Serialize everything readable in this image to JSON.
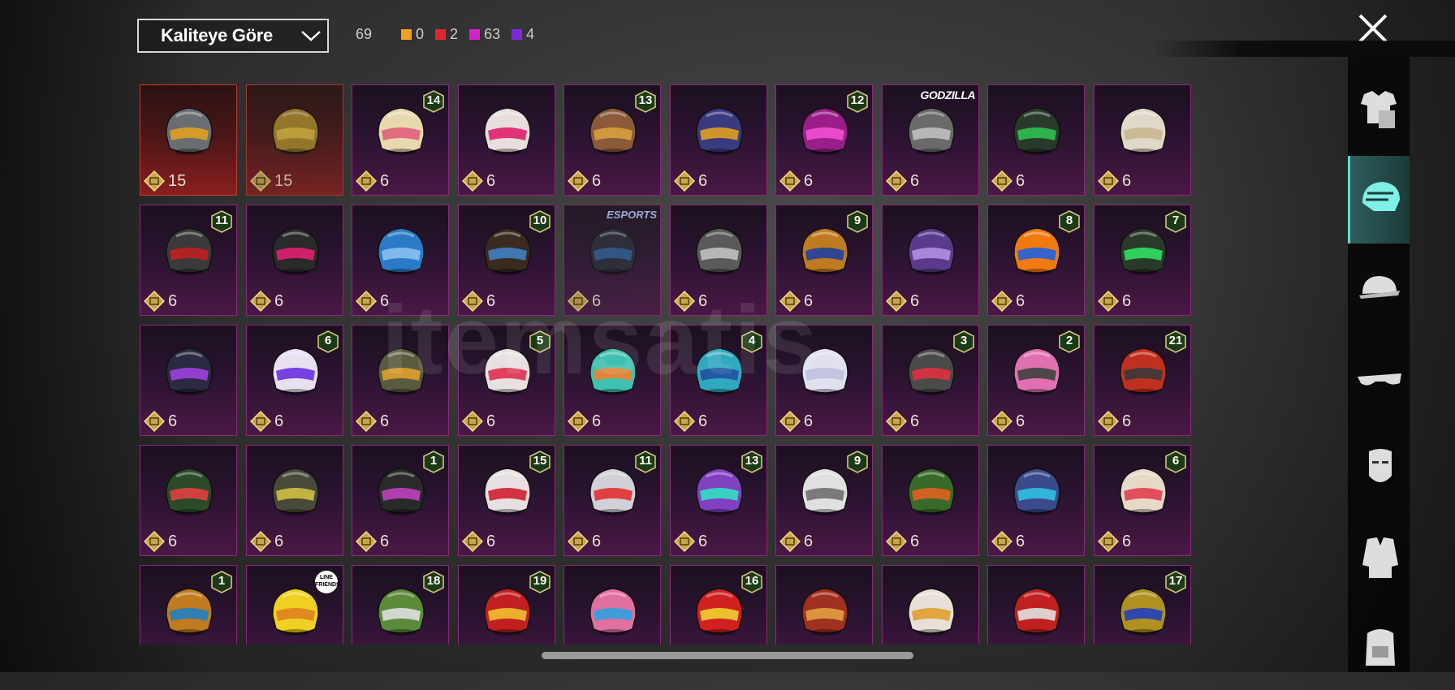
{
  "sort": {
    "label": "Kaliteye Göre"
  },
  "counts": {
    "total": "69",
    "items": [
      {
        "color": "#f2a01d",
        "value": "0"
      },
      {
        "color": "#e0262e",
        "value": "2"
      },
      {
        "color": "#d423c9",
        "value": "63"
      },
      {
        "color": "#7a2ad8",
        "value": "4"
      }
    ]
  },
  "watermark": "itemsatis",
  "tiles": [
    {
      "price": "15",
      "quality": "red",
      "helmet": "#6a6e72",
      "accent": "#e0a020"
    },
    {
      "price": "15",
      "quality": "red",
      "helmet": "#b08a2a",
      "accent": "#e8c040",
      "dim": true
    },
    {
      "price": "6",
      "helmet": "#e8d8b0",
      "accent": "#e0607a",
      "badge": "14"
    },
    {
      "price": "6",
      "helmet": "#e8dede",
      "accent": "#e0206e"
    },
    {
      "price": "6",
      "helmet": "#8a5a3a",
      "accent": "#d8a040",
      "badge": "13"
    },
    {
      "price": "6",
      "helmet": "#3a3a80",
      "accent": "#e0a020"
    },
    {
      "price": "6",
      "helmet": "#9a1e8a",
      "accent": "#f050d0",
      "badge": "12"
    },
    {
      "price": "6",
      "helmet": "#6a6a6a",
      "accent": "#c0c0c0",
      "label": "GODZILLA"
    },
    {
      "price": "6",
      "helmet": "#2a3a2a",
      "accent": "#30c050"
    },
    {
      "price": "6",
      "helmet": "#e0d8c8",
      "accent": "#c8b890"
    },
    {
      "price": "6",
      "helmet": "#3a3a3a",
      "accent": "#c02020",
      "badge": "11"
    },
    {
      "price": "6",
      "helmet": "#2a2a2a",
      "accent": "#e02070"
    },
    {
      "price": "6",
      "helmet": "#2a7ac8",
      "accent": "#8ac0f0"
    },
    {
      "price": "6",
      "helmet": "#3a2a20",
      "accent": "#4080c0",
      "badge": "10"
    },
    {
      "price": "6",
      "helmet": "#2a2a3a",
      "accent": "#3060a0",
      "label": "ESPORTS",
      "dim": true
    },
    {
      "price": "6",
      "helmet": "#5a5a5a",
      "accent": "#c0c0c0"
    },
    {
      "price": "6",
      "helmet": "#c07a20",
      "accent": "#2040a0",
      "badge": "9"
    },
    {
      "price": "6",
      "helmet": "#5a3a8a",
      "accent": "#b090e0"
    },
    {
      "price": "6",
      "helmet": "#f07a10",
      "accent": "#2060e0",
      "badge": "8"
    },
    {
      "price": "6",
      "helmet": "#2a3a2a",
      "accent": "#30e060",
      "badge": "7"
    },
    {
      "price": "6",
      "helmet": "#2a2a40",
      "accent": "#a040e0"
    },
    {
      "price": "6",
      "helmet": "#e8e0f0",
      "accent": "#6a30e0",
      "badge": "6"
    },
    {
      "price": "6",
      "helmet": "#5a5a40",
      "accent": "#e0a030"
    },
    {
      "price": "6",
      "helmet": "#e8e0e0",
      "accent": "#e03050",
      "badge": "5"
    },
    {
      "price": "6",
      "helmet": "#40c0b0",
      "accent": "#f08030"
    },
    {
      "price": "6",
      "helmet": "#30a8c0",
      "accent": "#2050a0",
      "badge": "4"
    },
    {
      "price": "6",
      "helmet": "#e0e0f0",
      "accent": "#c0c0e0"
    },
    {
      "price": "6",
      "helmet": "#4a4a4a",
      "accent": "#e03040",
      "badge": "3"
    },
    {
      "price": "6",
      "helmet": "#e070b0",
      "accent": "#404040",
      "badge": "2"
    },
    {
      "price": "6",
      "helmet": "#c03020",
      "accent": "#3a3a3a",
      "badge": "21"
    },
    {
      "price": "6",
      "helmet": "#2a4a2a",
      "accent": "#e04040"
    },
    {
      "price": "6",
      "helmet": "#4a4a3a",
      "accent": "#d0c040"
    },
    {
      "price": "6",
      "helmet": "#2a2a2a",
      "accent": "#c040c0",
      "badge": "1"
    },
    {
      "price": "6",
      "helmet": "#e8e0e0",
      "accent": "#d02030",
      "badge": "15"
    },
    {
      "price": "6",
      "helmet": "#d0d0d8",
      "accent": "#e03030",
      "badge": "11"
    },
    {
      "price": "6",
      "helmet": "#8040c0",
      "accent": "#30e0c0",
      "badge": "13"
    },
    {
      "price": "6",
      "helmet": "#e0e0e0",
      "accent": "#707070",
      "badge": "9"
    },
    {
      "price": "6",
      "helmet": "#3a6a2a",
      "accent": "#e06020"
    },
    {
      "price": "6",
      "helmet": "#3a4a8a",
      "accent": "#30c0e0"
    },
    {
      "price": "6",
      "helmet": "#e8d8c8",
      "accent": "#e04050",
      "badge": "6"
    },
    {
      "price": "",
      "helmet": "#c07a20",
      "accent": "#2080c0",
      "badge": "1"
    },
    {
      "price": "",
      "helmet": "#f0d020",
      "accent": "#e08020",
      "label": "LINE FRIENDS"
    },
    {
      "price": "",
      "helmet": "#5a8a3a",
      "accent": "#e0e0e0",
      "badge": "18"
    },
    {
      "price": "",
      "helmet": "#c02020",
      "accent": "#f0c030",
      "badge": "19"
    },
    {
      "price": "",
      "helmet": "#e070a0",
      "accent": "#30a0e0"
    },
    {
      "price": "",
      "helmet": "#d02020",
      "accent": "#f0d030",
      "badge": "16"
    },
    {
      "price": "",
      "helmet": "#a03020",
      "accent": "#e0a040"
    },
    {
      "price": "",
      "helmet": "#e8e0d8",
      "accent": "#e0a030"
    },
    {
      "price": "",
      "helmet": "#c02020",
      "accent": "#e0e0e0"
    },
    {
      "price": "",
      "helmet": "#b09020",
      "accent": "#2040c0",
      "badge": "17"
    }
  ],
  "sidebar": [
    {
      "name": "outfit-icon"
    },
    {
      "name": "helmet-icon",
      "active": true
    },
    {
      "name": "cap-icon"
    },
    {
      "name": "glasses-icon"
    },
    {
      "name": "mask-icon"
    },
    {
      "name": "jacket-icon"
    },
    {
      "name": "backpack-icon"
    }
  ]
}
